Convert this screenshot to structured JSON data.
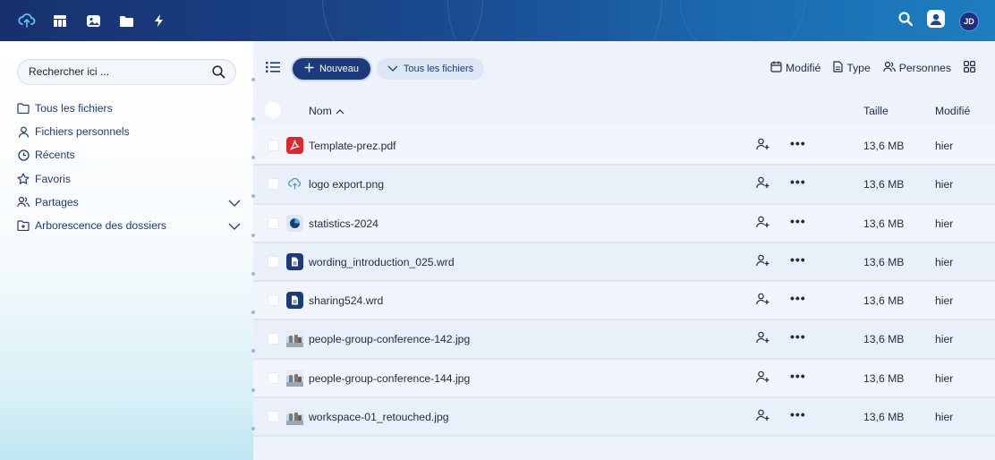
{
  "topbar": {
    "left_icons": [
      "cloud-sync-icon",
      "table-icon",
      "image-icon",
      "folder-icon",
      "bolt-icon"
    ],
    "right_icons": [
      "search-icon",
      "user-icon"
    ],
    "avatar_initials": "JD"
  },
  "sidebar": {
    "search_placeholder": "Rechercher ici ...",
    "items": [
      {
        "label": "Tous les fichiers",
        "icon": "folder-icon"
      },
      {
        "label": "Fichiers personnels",
        "icon": "user-icon"
      },
      {
        "label": "Récents",
        "icon": "clock-icon"
      },
      {
        "label": "Favoris",
        "icon": "star-icon"
      },
      {
        "label": "Partages",
        "icon": "users-icon",
        "expandable": true
      },
      {
        "label": "Arborescence des dossiers",
        "icon": "folder-plus-icon",
        "expandable": true
      }
    ]
  },
  "toolbar": {
    "new_label": "Nouveau",
    "all_files_label": "Tous les fichiers",
    "filters": {
      "modified": "Modifié",
      "type": "Type",
      "people": "Personnes"
    }
  },
  "table": {
    "headers": {
      "name": "Nom",
      "size": "Taille",
      "modified": "Modifié"
    },
    "rows": [
      {
        "name": "Template-prez.pdf",
        "type": "pdf",
        "size": "13,6 MB",
        "modified": "hier"
      },
      {
        "name": "logo export.png",
        "type": "png",
        "size": "13,6 MB",
        "modified": "hier"
      },
      {
        "name": "statistics-2024",
        "type": "stats",
        "size": "13,6 MB",
        "modified": "hier"
      },
      {
        "name": "wording_introduction_025.wrd",
        "type": "wrd",
        "size": "13,6 MB",
        "modified": "hier"
      },
      {
        "name": "sharing524.wrd",
        "type": "wrd",
        "size": "13,6 MB",
        "modified": "hier"
      },
      {
        "name": "people-group-conference-142.jpg",
        "type": "jpg",
        "size": "13,6 MB",
        "modified": "hier"
      },
      {
        "name": "people-group-conference-144.jpg",
        "type": "jpg",
        "size": "13,6 MB",
        "modified": "hier"
      },
      {
        "name": "workspace-01_retouched.jpg",
        "type": "jpg",
        "size": "13,6 MB",
        "modified": "hier"
      }
    ]
  },
  "colors": {
    "primary": "#1c3a7c",
    "topbar_start": "#17306e",
    "topbar_end": "#1c7fc0",
    "pdf": "#e4242b"
  }
}
